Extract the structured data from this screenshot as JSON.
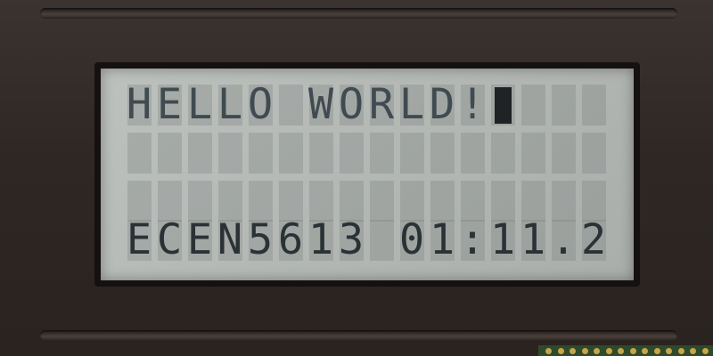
{
  "display": {
    "line1": "HELLO WORLD!",
    "line2": "",
    "line3": "",
    "line4": "ECEN5613 01:11.2",
    "columns": 16,
    "cursor_visible": true
  },
  "colors": {
    "bezel": "#2e2724",
    "lcd_background": "#b4b8b4",
    "text": "#2a3236"
  }
}
